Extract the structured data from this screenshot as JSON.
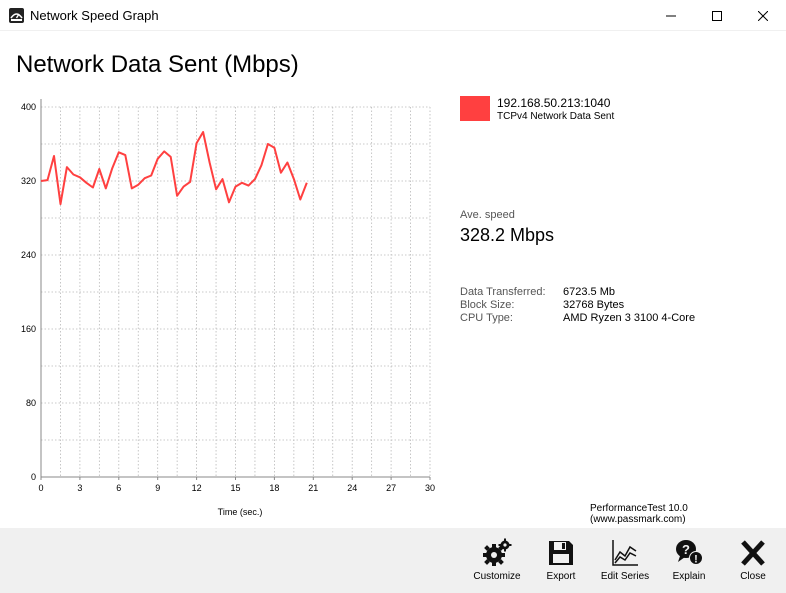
{
  "window": {
    "title": "Network Speed Graph",
    "controls": [
      "minimize",
      "maximize",
      "close"
    ]
  },
  "heading": "Network Data Sent (Mbps)",
  "chart_data": {
    "type": "line",
    "xlabel": "Time (sec.)",
    "ylabel": "",
    "xlim": [
      0,
      30
    ],
    "ylim": [
      0,
      400
    ],
    "x_ticks": [
      "0",
      "3",
      "6",
      "9",
      "12",
      "15",
      "18",
      "21",
      "24",
      "27",
      "30"
    ],
    "y_ticks": [
      "0",
      "80",
      "160",
      "240",
      "320",
      "400"
    ],
    "grid": true,
    "series": [
      {
        "name": "192.168.50.213:1040",
        "color": "#ff4040",
        "x": [
          0,
          0.5,
          1,
          1.5,
          2,
          2.5,
          3,
          3.5,
          4,
          4.5,
          5,
          5.5,
          6,
          6.5,
          7,
          7.5,
          8,
          8.5,
          9,
          9.5,
          10,
          10.5,
          11,
          11.5,
          12,
          12.5,
          13,
          13.5,
          14,
          14.5,
          15,
          15.5,
          16,
          16.5,
          17,
          17.5,
          18,
          18.5,
          19,
          19.5,
          20,
          20.5
        ],
        "values": [
          320,
          321,
          347,
          295,
          335,
          327,
          324,
          318,
          313,
          333,
          312,
          334,
          351,
          348,
          312,
          316,
          323,
          326,
          344,
          352,
          346,
          304,
          314,
          319,
          361,
          373,
          340,
          311,
          322,
          297,
          314,
          318,
          315,
          322,
          337,
          360,
          356,
          329,
          340,
          322,
          300,
          318
        ]
      }
    ]
  },
  "legend": {
    "color": "#ff4040",
    "name": "192.168.50.213:1040",
    "subtitle": "TCPv4 Network Data Sent"
  },
  "stats": {
    "ave_label": "Ave. speed",
    "ave_value": "328.2 Mbps",
    "rows": [
      {
        "label": "Data Transferred:",
        "value": "6723.5 Mb"
      },
      {
        "label": "Block Size:",
        "value": "32768 Bytes"
      },
      {
        "label": "CPU Type:",
        "value": "AMD Ryzen 3 3100 4-Core"
      }
    ]
  },
  "credit": "PerformanceTest 10.0 (www.passmark.com)",
  "toolbar": {
    "buttons": [
      {
        "label": "Customize",
        "icon": "gears-icon"
      },
      {
        "label": "Export",
        "icon": "floppy-disk-icon"
      },
      {
        "label": "Edit Series",
        "icon": "line-chart-icon"
      },
      {
        "label": "Explain",
        "icon": "question-exclamation-icon"
      },
      {
        "label": "Close",
        "icon": "x-close-icon"
      }
    ]
  }
}
